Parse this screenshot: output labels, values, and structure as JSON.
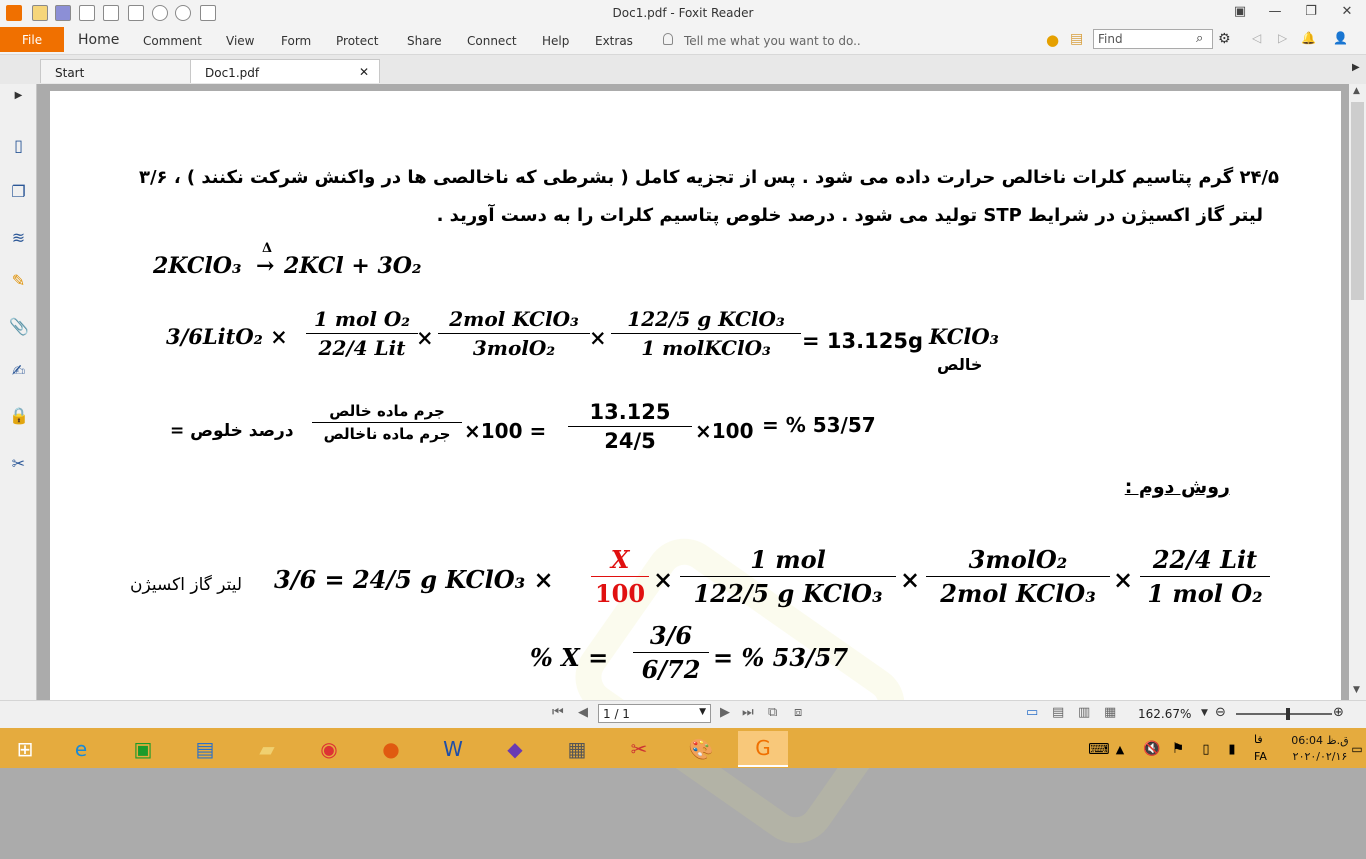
{
  "window": {
    "title": "Doc1.pdf - Foxit Reader"
  },
  "menu": {
    "file": "File",
    "home": "Home",
    "comment": "Comment",
    "view": "View",
    "form": "Form",
    "protect": "Protect",
    "share": "Share",
    "connect": "Connect",
    "help": "Help",
    "extras": "Extras",
    "tell_me": "Tell me what you want to do.."
  },
  "search": {
    "placeholder": "Find"
  },
  "tabs": [
    {
      "label": "Start"
    },
    {
      "label": "Doc1.pdf"
    }
  ],
  "doc": {
    "problem_line1": "۲۴/۵ گرم پتاسیم کلرات ناخالص حرارت داده می شود . پس از تجزیه کامل ( بشرطی که ناخالصی ها در واکنش شرکت نکنند ) ، ۳/۶",
    "problem_line2": "لیتر گاز اکسیژن در شرایط STP تولید می شود . درصد خلوص پتاسیم کلرات را به دست آورید .",
    "reaction_left": "2KClO₃",
    "reaction_delta": "Δ",
    "reaction_arrow": "→",
    "reaction_right": "2KCl + 3O₂",
    "calc_start": "3/6LitO₂ ×",
    "f1_num": "1 mol O₂",
    "f1_den": "22/4 Lit",
    "f2_num": "2mol KClO₃",
    "f2_den": "3molO₂",
    "f3_num": "122/5 g KClO₃",
    "f3_den": "1 molKClO₃",
    "calc_result": "= 13.125",
    "calc_unit": "g",
    "calc_species": "KClO₃",
    "calc_label": "خالص",
    "purity_label": "درصد خلوص =",
    "purity_num": "جرم ماده خالص",
    "purity_den": "جرم ماده ناخالص",
    "purity_mid": "×100 =",
    "purity_val_num": "13.125",
    "purity_val_den": "24/5",
    "purity_end": "×100",
    "purity_result": "= % 53/57",
    "method2": "روش دوم :",
    "m2_label": "لیتر گاز اکسیژن",
    "m2_left": "3/6 = 24/5 g KClO₃ ×",
    "m2_f1_num": "X",
    "m2_f1_den": "100",
    "m2_f2_num": "1 mol",
    "m2_f2_den": "122/5 g KClO₃",
    "m2_f3_num": "3molO₂",
    "m2_f3_den": "2mol KClO₃",
    "m2_f4_num": "22/4 Lit",
    "m2_f4_den": "1 mol O₂",
    "m3_left": "% X =",
    "m3_num": "3/6",
    "m3_den": "6/72",
    "m3_result": "= % 53/57"
  },
  "status": {
    "page_input": "1 / 1",
    "zoom": "162.67%"
  },
  "tray": {
    "lang": "FA",
    "time_label": "ق.ظ 06:04",
    "date": "۲۰۲۰/۰۲/۱۶",
    "lang_indicator": "فا"
  },
  "colors": {
    "accent": "#f07000",
    "taskbar": "#e5ab3e",
    "red": "#e01010"
  }
}
